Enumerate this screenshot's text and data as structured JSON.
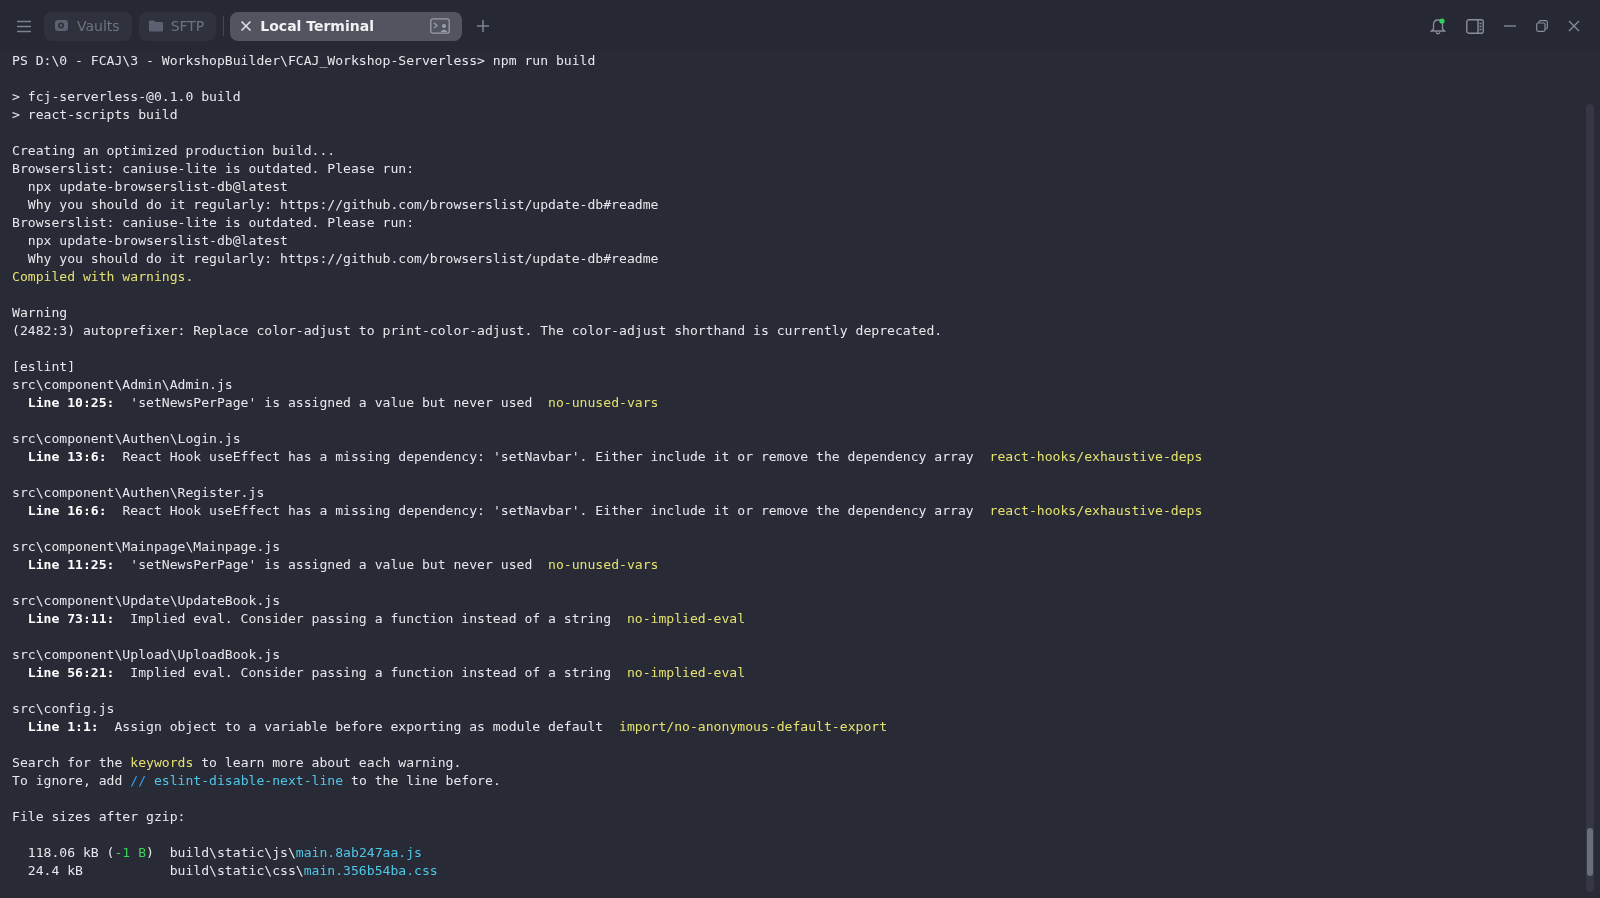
{
  "tabs": [
    {
      "label": "Vaults",
      "kind": "vault",
      "selected": false
    },
    {
      "label": "SFTP",
      "kind": "folder",
      "selected": false
    },
    {
      "label": "Local Terminal",
      "kind": "terminal",
      "selected": true
    }
  ],
  "notifications": {
    "unread": true
  },
  "terminal": {
    "lines": [
      {
        "kind": "text",
        "segments": [
          {
            "text": "PS D:\\0 - FCAJ\\3 - WorkshopBuilder\\FCAJ_Workshop-Serverless> npm run build",
            "kind": "plain"
          }
        ]
      },
      {
        "kind": "blank"
      },
      {
        "kind": "text",
        "segments": [
          {
            "text": "> fcj-serverless-@0.1.0 build",
            "kind": "plain"
          }
        ]
      },
      {
        "kind": "text",
        "segments": [
          {
            "text": "> react-scripts build",
            "kind": "plain"
          }
        ]
      },
      {
        "kind": "blank"
      },
      {
        "kind": "text",
        "segments": [
          {
            "text": "Creating an optimized production build...",
            "kind": "plain"
          }
        ]
      },
      {
        "kind": "text",
        "segments": [
          {
            "text": "Browserslist: caniuse-lite is outdated. Please run:",
            "kind": "plain"
          }
        ]
      },
      {
        "kind": "text",
        "segments": [
          {
            "text": "  npx update-browserslist-db@latest",
            "kind": "plain"
          }
        ]
      },
      {
        "kind": "text",
        "segments": [
          {
            "text": "  Why you should do it regularly: https://github.com/browserslist/update-db#readme",
            "kind": "plain"
          }
        ]
      },
      {
        "kind": "text",
        "segments": [
          {
            "text": "Browserslist: caniuse-lite is outdated. Please run:",
            "kind": "plain"
          }
        ]
      },
      {
        "kind": "text",
        "segments": [
          {
            "text": "  npx update-browserslist-db@latest",
            "kind": "plain"
          }
        ]
      },
      {
        "kind": "text",
        "segments": [
          {
            "text": "  Why you should do it regularly: https://github.com/browserslist/update-db#readme",
            "kind": "plain"
          }
        ]
      },
      {
        "kind": "text",
        "segments": [
          {
            "text": "Compiled with warnings.",
            "kind": "yellow"
          }
        ]
      },
      {
        "kind": "blank"
      },
      {
        "kind": "text",
        "segments": [
          {
            "text": "Warning",
            "kind": "plain"
          }
        ]
      },
      {
        "kind": "text",
        "segments": [
          {
            "text": "(2482:3) autoprefixer: Replace color-adjust to print-color-adjust. The color-adjust shorthand is currently deprecated.",
            "kind": "plain"
          }
        ]
      },
      {
        "kind": "blank"
      },
      {
        "kind": "text",
        "segments": [
          {
            "text": "[eslint]",
            "kind": "plain"
          }
        ]
      },
      {
        "kind": "text",
        "segments": [
          {
            "text": "src\\component\\Admin\\Admin.js",
            "kind": "plain"
          }
        ]
      },
      {
        "kind": "text",
        "segments": [
          {
            "text": "  Line 10:25:",
            "kind": "bold"
          },
          {
            "text": "  'setNewsPerPage' is assigned a value but never used  ",
            "kind": "plain"
          },
          {
            "text": "no-unused-vars",
            "kind": "yellow"
          }
        ]
      },
      {
        "kind": "blank"
      },
      {
        "kind": "text",
        "segments": [
          {
            "text": "src\\component\\Authen\\Login.js",
            "kind": "plain"
          }
        ]
      },
      {
        "kind": "text",
        "segments": [
          {
            "text": "  Line 13:6:",
            "kind": "bold"
          },
          {
            "text": "  React Hook useEffect has a missing dependency: 'setNavbar'. Either include it or remove the dependency array  ",
            "kind": "plain"
          },
          {
            "text": "react-hooks/exhaustive-deps",
            "kind": "yellow"
          }
        ]
      },
      {
        "kind": "blank"
      },
      {
        "kind": "text",
        "segments": [
          {
            "text": "src\\component\\Authen\\Register.js",
            "kind": "plain"
          }
        ]
      },
      {
        "kind": "text",
        "segments": [
          {
            "text": "  Line 16:6:",
            "kind": "bold"
          },
          {
            "text": "  React Hook useEffect has a missing dependency: 'setNavbar'. Either include it or remove the dependency array  ",
            "kind": "plain"
          },
          {
            "text": "react-hooks/exhaustive-deps",
            "kind": "yellow"
          }
        ]
      },
      {
        "kind": "blank"
      },
      {
        "kind": "text",
        "segments": [
          {
            "text": "src\\component\\Mainpage\\Mainpage.js",
            "kind": "plain"
          }
        ]
      },
      {
        "kind": "text",
        "segments": [
          {
            "text": "  Line 11:25:",
            "kind": "bold"
          },
          {
            "text": "  'setNewsPerPage' is assigned a value but never used  ",
            "kind": "plain"
          },
          {
            "text": "no-unused-vars",
            "kind": "yellow"
          }
        ]
      },
      {
        "kind": "blank"
      },
      {
        "kind": "text",
        "segments": [
          {
            "text": "src\\component\\Update\\UpdateBook.js",
            "kind": "plain"
          }
        ]
      },
      {
        "kind": "text",
        "segments": [
          {
            "text": "  Line 73:11:",
            "kind": "bold"
          },
          {
            "text": "  Implied eval. Consider passing a function instead of a string  ",
            "kind": "plain"
          },
          {
            "text": "no-implied-eval",
            "kind": "yellow"
          }
        ]
      },
      {
        "kind": "blank"
      },
      {
        "kind": "text",
        "segments": [
          {
            "text": "src\\component\\Upload\\UploadBook.js",
            "kind": "plain"
          }
        ]
      },
      {
        "kind": "text",
        "segments": [
          {
            "text": "  Line 56:21:",
            "kind": "bold"
          },
          {
            "text": "  Implied eval. Consider passing a function instead of a string  ",
            "kind": "plain"
          },
          {
            "text": "no-implied-eval",
            "kind": "yellow"
          }
        ]
      },
      {
        "kind": "blank"
      },
      {
        "kind": "text",
        "segments": [
          {
            "text": "src\\config.js",
            "kind": "plain"
          }
        ]
      },
      {
        "kind": "text",
        "segments": [
          {
            "text": "  Line 1:1:",
            "kind": "bold"
          },
          {
            "text": "  Assign object to a variable before exporting as module default  ",
            "kind": "plain"
          },
          {
            "text": "import/no-anonymous-default-export",
            "kind": "yellow"
          }
        ]
      },
      {
        "kind": "blank"
      },
      {
        "kind": "text",
        "segments": [
          {
            "text": "Search for the ",
            "kind": "plain"
          },
          {
            "text": "keywords",
            "kind": "yellow"
          },
          {
            "text": " to learn more about each warning.",
            "kind": "plain"
          }
        ]
      },
      {
        "kind": "text",
        "segments": [
          {
            "text": "To ignore, add ",
            "kind": "plain"
          },
          {
            "text": "//",
            "kind": "blue"
          },
          {
            "text": " eslint-disable-next-line",
            "kind": "cyan"
          },
          {
            "text": " to the line before.",
            "kind": "plain"
          }
        ]
      },
      {
        "kind": "blank"
      },
      {
        "kind": "text",
        "segments": [
          {
            "text": "File sizes after gzip:",
            "kind": "plain"
          }
        ]
      },
      {
        "kind": "blank"
      },
      {
        "kind": "text",
        "segments": [
          {
            "text": "  118.06 kB (",
            "kind": "plain"
          },
          {
            "text": "-1 B",
            "kind": "green"
          },
          {
            "text": ")  build\\static\\js\\",
            "kind": "plain"
          },
          {
            "text": "main.8ab247aa.js",
            "kind": "cyan"
          }
        ]
      },
      {
        "kind": "text",
        "segments": [
          {
            "text": "  24.4 kB           build\\static\\css\\",
            "kind": "plain"
          },
          {
            "text": "main.356b54ba.css",
            "kind": "cyan"
          }
        ]
      }
    ]
  }
}
